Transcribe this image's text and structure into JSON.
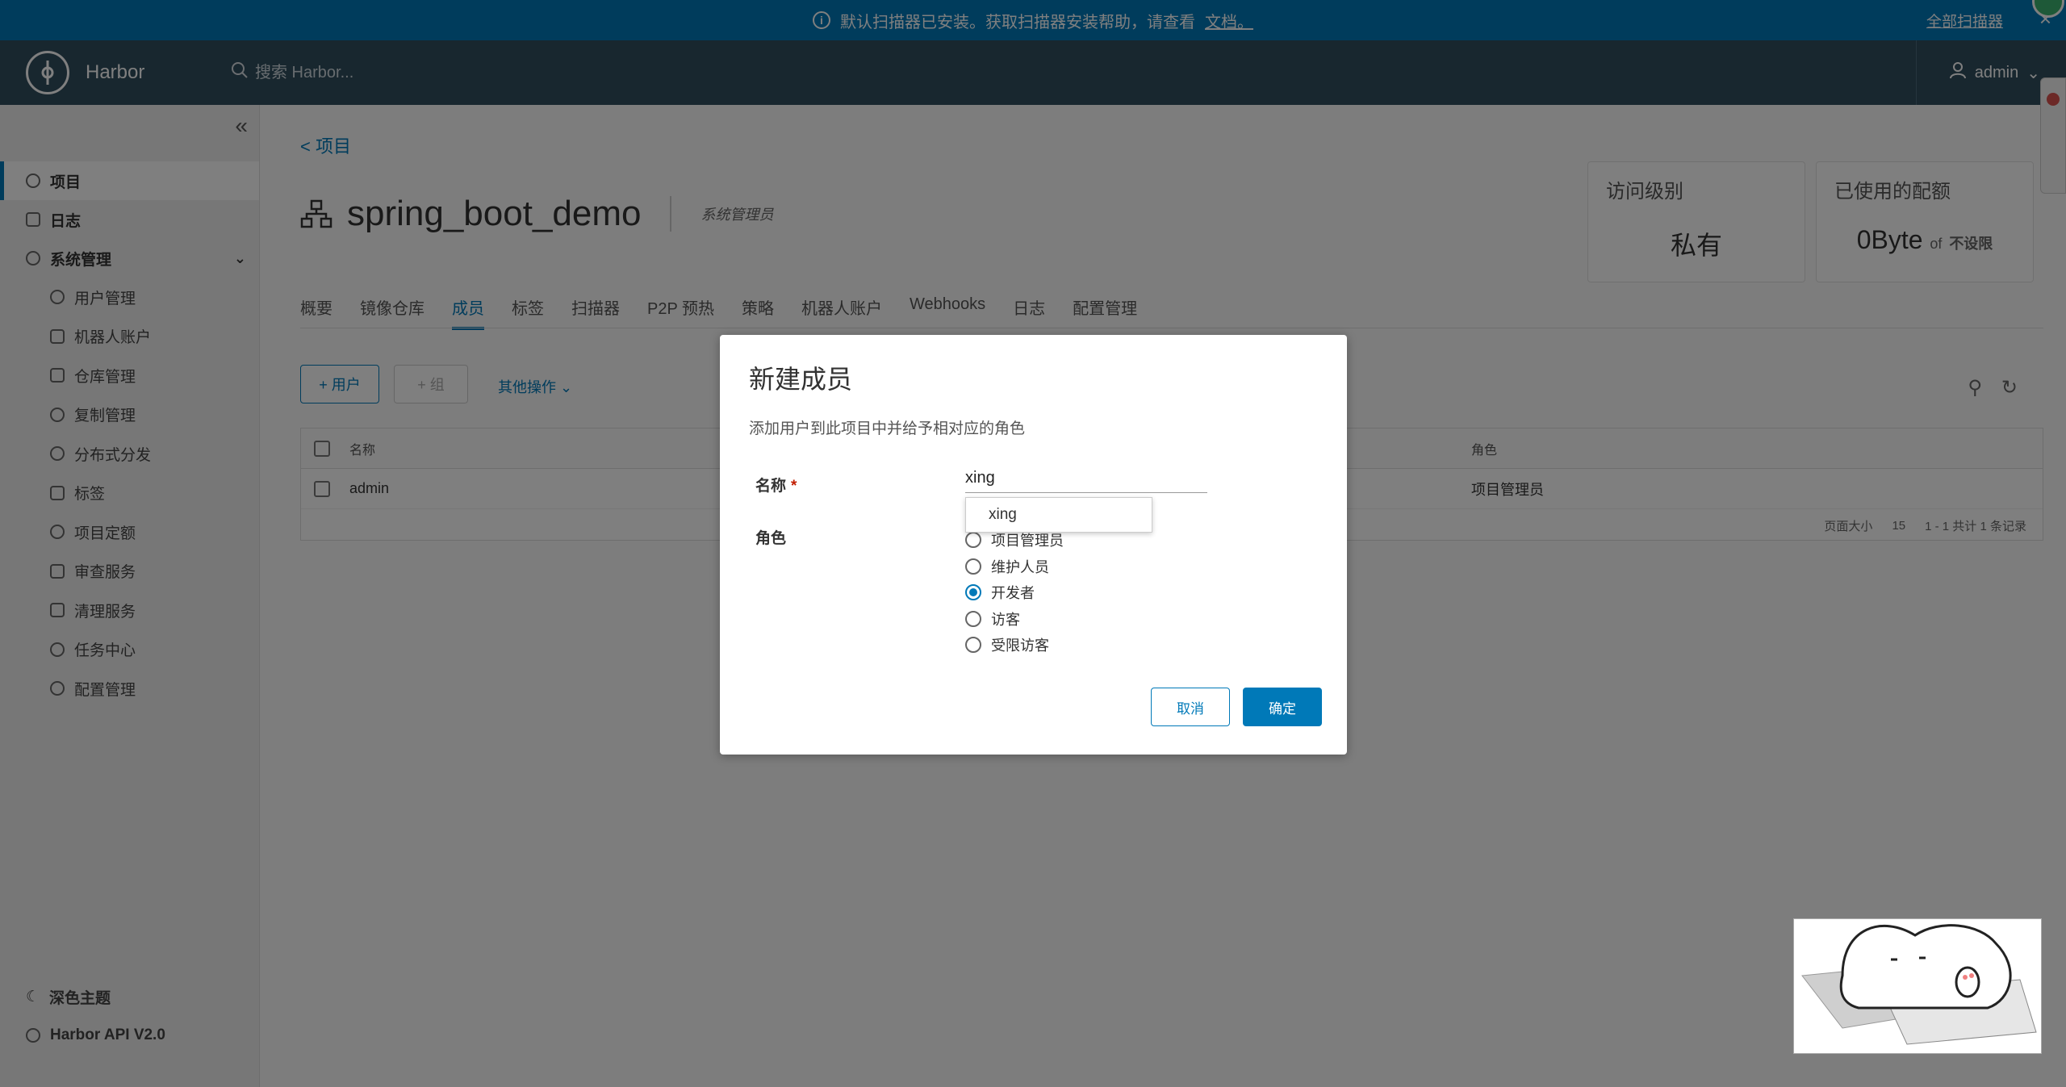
{
  "banner": {
    "message": "默认扫描器已安装。获取扫描器安装帮助，请查看",
    "link": "文档。",
    "scan_all": "全部扫描器"
  },
  "header": {
    "brand": "Harbor",
    "search_placeholder": "搜索 Harbor...",
    "user": "admin"
  },
  "sidebar": {
    "items": [
      {
        "label": "项目",
        "icon": "projects-icon",
        "active": true
      },
      {
        "label": "日志",
        "icon": "logs-icon"
      },
      {
        "label": "系统管理",
        "icon": "admin-icon"
      }
    ],
    "sub_items": [
      {
        "label": "用户管理",
        "icon": "users-icon"
      },
      {
        "label": "机器人账户",
        "icon": "robot-icon"
      },
      {
        "label": "仓库管理",
        "icon": "registry-icon"
      },
      {
        "label": "复制管理",
        "icon": "replication-icon"
      },
      {
        "label": "分布式分发",
        "icon": "share-icon"
      },
      {
        "label": "标签",
        "icon": "tag-icon"
      },
      {
        "label": "项目定额",
        "icon": "quota-icon"
      },
      {
        "label": "审查服务",
        "icon": "shield-icon"
      },
      {
        "label": "清理服务",
        "icon": "trash-icon"
      },
      {
        "label": "任务中心",
        "icon": "dashboard-icon"
      },
      {
        "label": "配置管理",
        "icon": "gear-icon"
      }
    ],
    "bottom": [
      {
        "label": "深色主题",
        "icon": "moon-icon"
      },
      {
        "label": "Harbor API V2.0",
        "icon": "api-icon"
      }
    ]
  },
  "page": {
    "breadcrumb": "< 项目",
    "title": "spring_boot_demo",
    "role": "系统管理员",
    "cards": [
      {
        "label": "访问级别",
        "value": "私有"
      },
      {
        "label": "已使用的配额",
        "value": "0Byte",
        "suffix": "of",
        "suffix_strong": "不设限"
      }
    ],
    "tabs": [
      "概要",
      "镜像仓库",
      "成员",
      "标签",
      "扫描器",
      "P2P 预热",
      "策略",
      "机器人账户",
      "Webhooks",
      "日志",
      "配置管理"
    ],
    "active_tab": "成员",
    "toolbar": {
      "add_user": "+ 用户",
      "add_group": "+ 组",
      "other_ops": "其他操作"
    },
    "table": {
      "columns": [
        "名称",
        "角色"
      ],
      "rows": [
        {
          "name": "admin",
          "role": "项目管理员"
        }
      ],
      "page_size_label": "页面大小",
      "page_size": "15",
      "summary": "1 - 1 共计 1 条记录"
    }
  },
  "modal": {
    "title": "新建成员",
    "desc": "添加用户到此项目中并给予相对应的角色",
    "name_label": "名称",
    "name_value": "xing",
    "suggestion": "xing",
    "role_label": "角色",
    "roles": [
      "项目管理员",
      "维护人员",
      "开发者",
      "访客",
      "受限访客"
    ],
    "selected_role": "开发者",
    "cancel": "取消",
    "ok": "确定"
  },
  "colors": {
    "primary": "#0079b8",
    "header": "#314e5f"
  }
}
